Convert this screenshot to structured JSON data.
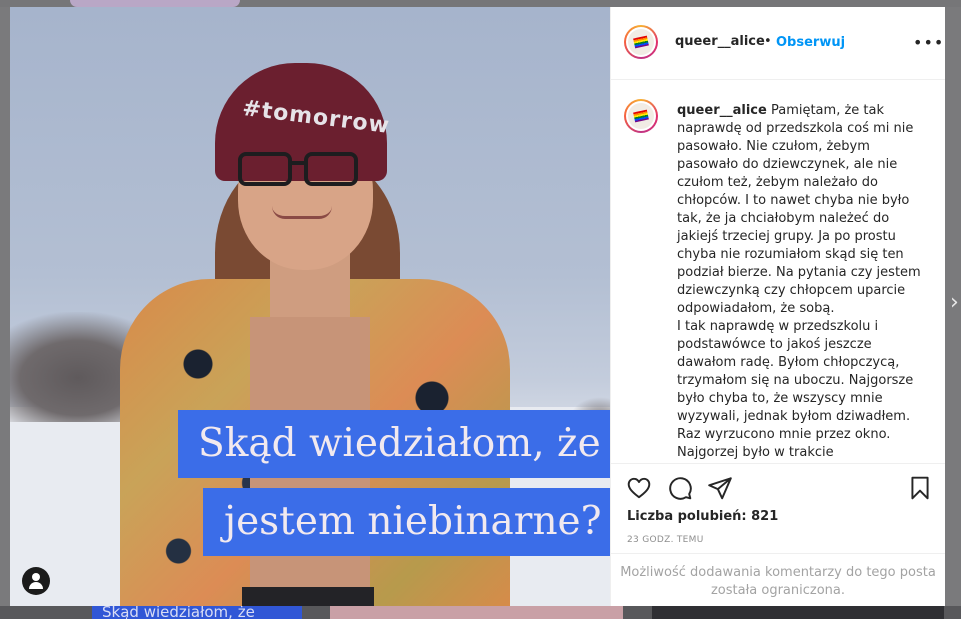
{
  "post": {
    "username": "queer__alice",
    "separator": "•",
    "follow_label": "Obserwuj",
    "more_label": "•••",
    "caption": "Pamiętam, że tak naprawdę od przedszkola coś mi nie pasowało. Nie czułom, żebym pasowało do dziewczynek, ale nie czułom też, żebym należało do chłopców. I to nawet chyba nie było tak, że ja chciałobym należeć do jakiejś trzeciej grupy. Ja po prostu chyba nie rozumiałom skąd się ten podział bierze. Na pytania czy jestem dziewczynką czy chłopcem uparcie odpowiadałom, że sobą.\nI tak naprawdę w przedszkolu i podstawówce to jakoś jeszcze dawałom radę. Byłom chłopczycą, trzymałom się na uboczu. Najgorsze było chyba to, że wszyscy mnie wyzywali, jednak byłom dziwadłem. Raz wyrzucono mnie przez okno. Najgorzej było w trakcie",
    "likes_text": "Liczba polubień: 821",
    "time_text": "23 GODZ. TEMU",
    "comments_disabled": "Możliwość dodawania komentarzy do tego posta została ograniczona."
  },
  "image": {
    "overlay_line1": "Skąd wiedziałom, że",
    "overlay_line2": "jestem niebinarne?",
    "beanie_text": "#tomorrow",
    "overlay_color": "#3b6de8"
  },
  "background": {
    "bottom_thumb_text": "Skąd wiedziałom, że",
    "next_label": "›"
  },
  "icons": [
    "heart-icon",
    "comment-icon",
    "share-icon",
    "bookmark-icon",
    "more-icon",
    "tag-user-icon",
    "rainbow-flag-icon"
  ],
  "colors": {
    "accent": "#0095f6",
    "text": "#262626",
    "muted": "#8e8e8e"
  }
}
